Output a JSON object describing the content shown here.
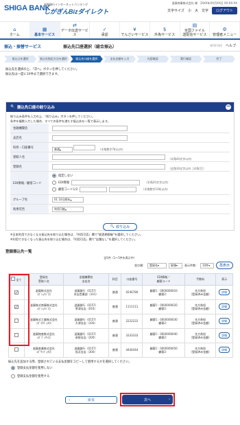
{
  "brand": {
    "bank": "SHIGA BANK",
    "service_small": "滋賀銀行インターネットバンキング",
    "service": "しがぎんBizダイレクト"
  },
  "header": {
    "user_info": "滋賀商事株式会社 様　20XX年XX月XX日 XX:XX:XX",
    "size_label": "文字サイズ",
    "size_small": "小",
    "size_large": "大",
    "font_menu": "文字",
    "logout": "ログアウト"
  },
  "nav": [
    {
      "icon": "⌂",
      "label": "ホーム"
    },
    {
      "icon": "▦",
      "label": "基本サービス"
    },
    {
      "icon": "⇄",
      "label": "データ伝送サービス"
    },
    {
      "icon": "✓",
      "label": "承認"
    },
    {
      "icon": "¥",
      "label": "でんさいサービス"
    },
    {
      "icon": "$",
      "label": "外為サービス"
    },
    {
      "icon": "▤",
      "label": "全国ファイル\n送配信サービス"
    },
    {
      "icon": "⚙",
      "label": "管理者メニュー"
    }
  ],
  "titlebar": {
    "section": "振込・振替サービス",
    "page": "振込先口座選択（総合振込）",
    "code": "BFKF000",
    "help": "ヘルプ"
  },
  "steps": [
    "振込元を選択",
    "振込先指定方法を選択",
    "振込先口座を選択",
    "支払金額を入力",
    "内容確認",
    "実行確認",
    "完了"
  ],
  "intro": [
    "振込先を選択の上、「次へ」ボタンを押してください。",
    "振込先は一度に10件まで選択できます。"
  ],
  "filter": {
    "title": "振込先口座の絞り込み",
    "instructions": [
      "絞り込み条件を入力の上、「絞り込み」ボタンを押してください。",
      "条件を複数入力した場合、すべての条件を満たす振込先を一覧で表示します。"
    ],
    "bank_label": "金融機関名",
    "branch_label": "支店名",
    "account_label": "科目・口座番号",
    "account_type": "普通",
    "account_hint": "（半角数字7桁以内）",
    "payee_label": "受取人名",
    "payee_hint": "（半角40文字以内）",
    "registered_label": "登録名",
    "registered_hint": "（全角30文字以内［半角可］）",
    "edi_label": "EDI情報／顧客コード",
    "edi_options": [
      "指定しない",
      "EDI情報",
      "顧客コード1/2"
    ],
    "edi_hint": "（半角20文字以内）",
    "edi_hint2": "（半角数字10桁以内）",
    "group_label": "グループ名",
    "group_value": "01 10日締め",
    "usage_label": "利用可否",
    "usage_value": "利用可能",
    "button": "絞り込み",
    "notes": [
      "※日本利用できなくなる振込先を絞り込む場合は、「利用可否」欄で\"経過期間後\"を選択してください。",
      "※利用できなくなった振込先を絞り込む場合は、「利用可否」欄で\"店舗なし\"を選択してください。"
    ]
  },
  "list": {
    "title": "登録振込先一覧",
    "count_text": "全5件（1〜5件を表示中）",
    "sort_label": "並び順：",
    "sort_value": "登録名",
    "order_value": "昇順",
    "per_page_label": "表示件数：",
    "per_page_value": "10件",
    "redisplay": "再表示",
    "headers": [
      "全て",
      "登録名\n受取人名",
      "金融機関名\n支店名",
      "科目",
      "口座番号",
      "EDI情報／\n顧客コード",
      "手数料",
      "表示"
    ],
    "rows": [
      {
        "checked": "✓",
        "name": "滋賀株式会社\nｼｶﾞｼｮｳｼﾞ(ｶ",
        "bank": "滋賀銀行（0157）\n本店営業部（101）",
        "type": "普通",
        "acct": "0246780",
        "code": "顧客1：0000000010\n顧客2：",
        "fee": "先方負担\n（登録済み金額）",
        "detail": "詳細"
      },
      {
        "checked": "✓",
        "name": "滋賀株式商事株式会社\nｼｶﾞｼｮｳｼﾞ(ｶ",
        "bank": "滋賀銀行（0157）\n草津支店（016）",
        "type": "普通",
        "acct": "1111111",
        "code": "顧客1：0000000020\n顧客2：",
        "fee": "先方負担\n（登録済み金額）",
        "detail": "詳細"
      },
      {
        "checked": "",
        "name": "滋賀株式工業株式会社\nｼｶﾞｺｳｷﾞｮｳ(ｶ",
        "bank": "滋賀銀行（0157）\n大津支店（100）",
        "type": "普通",
        "acct": "2222222",
        "code": "顧客1：0000000030\n顧客2：",
        "fee": "先方負担\n（登録済み金額）",
        "detail": "詳細"
      },
      {
        "checked": "",
        "name": "滋賀物産株式会社\nｼｶﾞﾌﾞｯｻﾝ(ｶ",
        "bank": "滋賀銀行（0157）\n彦根支店（200）",
        "type": "普通",
        "acct": "3333333",
        "code": "顧客1：0000000040\n顧客2：",
        "fee": "先方負担\n（登録済み金額）",
        "detail": "詳細"
      },
      {
        "checked": "",
        "name": "滋賀産業株式会社\nｼｶﾞｻﾝｷﾞｮｳ(ｶ",
        "bank": "滋賀銀行（0157）\n長浜支店（300）",
        "type": "普通",
        "acct": "4444444",
        "code": "顧客1：0000000050\n顧客2：",
        "fee": "先方負担\n（登録済み金額）",
        "detail": "詳細"
      }
    ]
  },
  "bottom": {
    "note": "振込先を追加する際、登録されている支払金額をコピーして使用するかを選択してください。",
    "opt1": "登録支払金額を使用しない",
    "opt2": "登録支払金額を使用する",
    "back": "戻る",
    "next": "次へ"
  },
  "colors": {
    "primary": "#1e3f8c",
    "accent": "#1f5fa6",
    "highlight": "#e8191f"
  }
}
